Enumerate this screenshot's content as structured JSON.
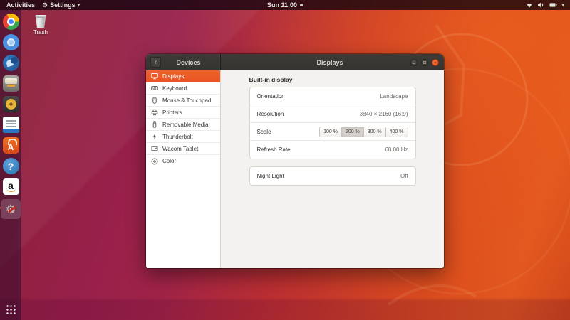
{
  "topbar": {
    "activities": "Activities",
    "app_menu": "Settings",
    "clock": "Sun 11:00"
  },
  "desktop": {
    "trash_label": "Trash"
  },
  "dock": {
    "items": [
      "chrome",
      "chromium",
      "thunderbird",
      "files",
      "rhythmbox",
      "libreoffice-writer",
      "ubuntu-software",
      "help",
      "amazon",
      "settings"
    ],
    "active_item": "settings",
    "software_letter": "A",
    "help_glyph": "?",
    "amazon_letter": "a",
    "settings_glyph": "⚙"
  },
  "window": {
    "back_title": "Devices",
    "title": "Displays",
    "sidebar": [
      {
        "label": "Displays",
        "icon": "display-icon",
        "selected": true
      },
      {
        "label": "Keyboard",
        "icon": "keyboard-icon",
        "selected": false
      },
      {
        "label": "Mouse & Touchpad",
        "icon": "mouse-icon",
        "selected": false
      },
      {
        "label": "Printers",
        "icon": "printer-icon",
        "selected": false
      },
      {
        "label": "Removable Media",
        "icon": "usb-icon",
        "selected": false
      },
      {
        "label": "Thunderbolt",
        "icon": "thunderbolt-icon",
        "selected": false
      },
      {
        "label": "Wacom Tablet",
        "icon": "tablet-icon",
        "selected": false
      },
      {
        "label": "Color",
        "icon": "color-icon",
        "selected": false
      }
    ],
    "content": {
      "section_title": "Built-in display",
      "rows": [
        {
          "label": "Orientation",
          "value": "Landscape"
        },
        {
          "label": "Resolution",
          "value": "3840 × 2160 (16:9)"
        },
        {
          "label": "Scale",
          "options": [
            "100 %",
            "200 %",
            "300 %",
            "400 %"
          ],
          "selected": "200 %"
        },
        {
          "label": "Refresh Rate",
          "value": "60.00 Hz"
        }
      ],
      "night_light": {
        "label": "Night Light",
        "value": "Off"
      }
    }
  },
  "colors": {
    "accent": "#e95420",
    "titlebar": "#3a3834",
    "sidebar_selected": "#e95420",
    "wallpaper_orange": "#e0561f",
    "wallpaper_purple": "#8c2136"
  }
}
